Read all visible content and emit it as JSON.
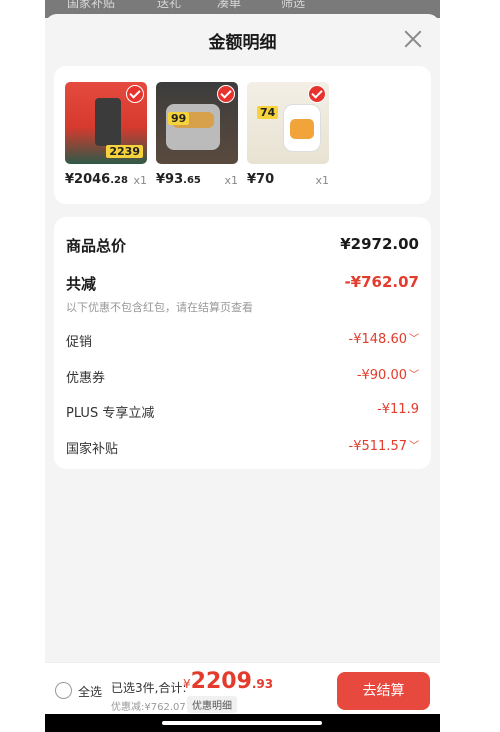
{
  "background_tabs": [
    "国家补贴",
    "送礼",
    "凑单",
    "筛选"
  ],
  "sheet": {
    "title": "金额明细"
  },
  "products": [
    {
      "price_main": "¥2046",
      "price_dec": ".28",
      "qty": "x1",
      "tag": "2239"
    },
    {
      "price_main": "¥93",
      "price_dec": ".65",
      "qty": "x1",
      "tag": "99"
    },
    {
      "price_main": "¥70",
      "price_dec": "",
      "qty": "x1",
      "tag": "74"
    }
  ],
  "summary": {
    "total_label": "商品总价",
    "total_value": "¥2972.00",
    "reduce_label": "共减",
    "reduce_value": "-¥762.07",
    "note": "以下优惠不包含红包，请在结算页查看",
    "items": [
      {
        "label": "促销",
        "value": "-¥148.60"
      },
      {
        "label": "优惠券",
        "value": "-¥90.00"
      },
      {
        "label": "PLUS 专享立减",
        "value": "-¥11.9"
      },
      {
        "label": "国家补贴",
        "value": "-¥511.57"
      }
    ]
  },
  "bottom": {
    "select_all": "全选",
    "selected_text": "已选3件,合计:",
    "currency": "¥",
    "total_int": "2209",
    "total_dec": ".93",
    "discount_text": "优惠减:¥762.07",
    "detail_label": "优惠明细",
    "checkout_label": "去结算"
  },
  "colors": {
    "accent": "#e33b2c",
    "checkout": "#e8493f"
  }
}
